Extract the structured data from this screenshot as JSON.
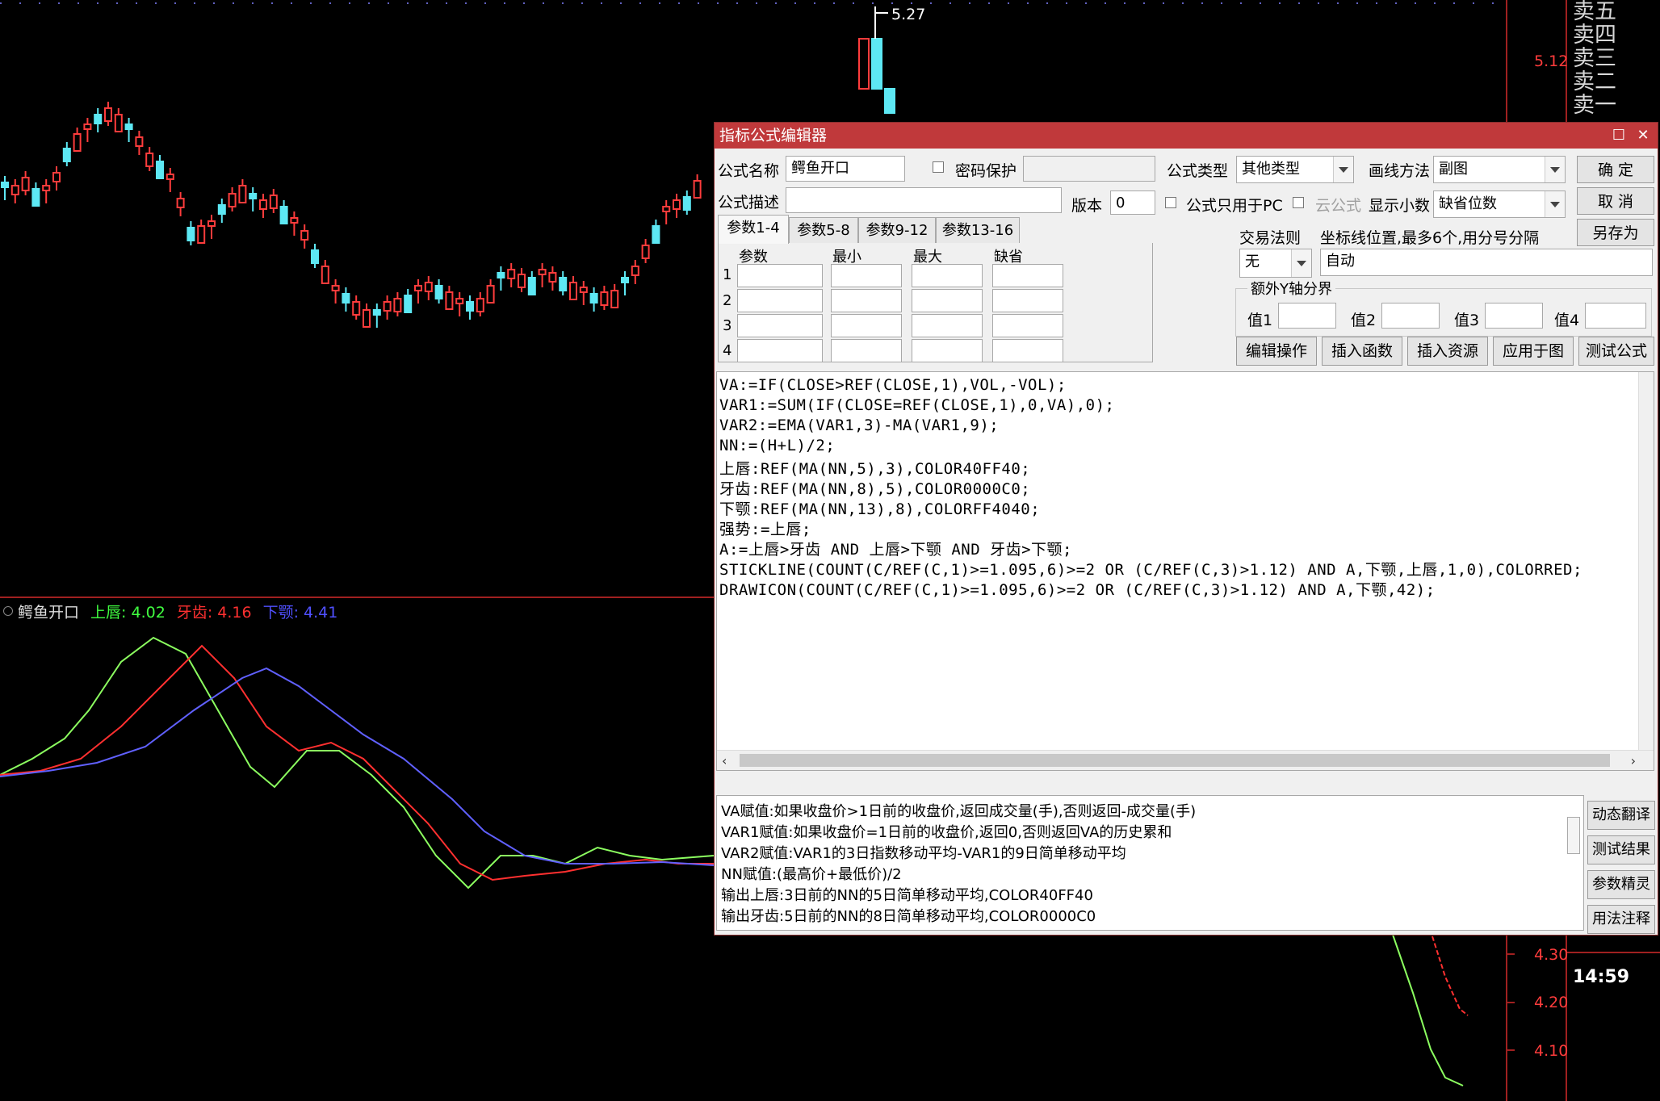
{
  "chart": {
    "price_high_label": "5.27",
    "price_axis_labels": [
      "5.12",
      "4.30",
      "4.20",
      "4.10"
    ],
    "time_label": "14:59",
    "orderbook": [
      "卖五",
      "卖四",
      "卖三",
      "卖二",
      "卖一"
    ],
    "indicator_name": "鳄鱼开口",
    "indicator_values": [
      {
        "name": "上唇",
        "value": "4.02",
        "color": "#40ff40"
      },
      {
        "name": "牙齿",
        "value": "4.16",
        "color": "#ff3030"
      },
      {
        "name": "下颚",
        "value": "4.41",
        "color": "#5050ff"
      }
    ]
  },
  "dialog": {
    "title": "指标公式编辑器",
    "labels": {
      "formula_name": "公式名称",
      "password": "密码保护",
      "formula_type": "公式类型",
      "draw_method": "画线方法",
      "formula_desc": "公式描述",
      "version": "版本",
      "pc_only": "公式只用于PC",
      "cloud": "云公式",
      "decimals": "显示小数",
      "trade_rule": "交易法则",
      "coord_hint": "坐标线位置,最多6个,用分号分隔",
      "extra_y": "额外Y轴分界",
      "val1": "值1",
      "val2": "值2",
      "val3": "值3",
      "val4": "值4"
    },
    "values": {
      "formula_name": "鳄鱼开口",
      "formula_type": "其他类型",
      "draw_method": "副图",
      "version": "0",
      "decimals": "缺省位数",
      "trade_rule": "无",
      "coord": "自动"
    },
    "buttons": {
      "ok": "确  定",
      "cancel": "取  消",
      "save_as": "另存为",
      "edit_ops": "编辑操作",
      "insert_func": "插入函数",
      "insert_res": "插入资源",
      "apply": "应用于图",
      "test": "测试公式",
      "dyn_translate": "动态翻译",
      "test_result": "测试结果",
      "param_wizard": "参数精灵",
      "usage_note": "用法注释"
    },
    "tabs": [
      "参数1-4",
      "参数5-8",
      "参数9-12",
      "参数13-16"
    ],
    "param_headers": [
      "参数",
      "最小",
      "最大",
      "缺省"
    ],
    "param_rows": [
      "1",
      "2",
      "3",
      "4"
    ],
    "code_lines": [
      "VA:=IF(CLOSE>REF(CLOSE,1),VOL,-VOL);",
      "VAR1:=SUM(IF(CLOSE=REF(CLOSE,1),0,VA),0);",
      "VAR2:=EMA(VAR1,3)-MA(VAR1,9);",
      "NN:=(H+L)/2;",
      "上唇:REF(MA(NN,5),3),COLOR40FF40;",
      "牙齿:REF(MA(NN,8),5),COLOR0000C0;",
      "下颚:REF(MA(NN,13),8),COLORFF4040;",
      "强势:=上唇;",
      "A:=上唇>牙齿 AND 上唇>下颚 AND 牙齿>下颚;",
      "STICKLINE(COUNT(C/REF(C,1)>=1.095,6)>=2 OR (C/REF(C,3)>1.12) AND A,下颚,上唇,1,0),COLORRED;",
      "DRAWICON(COUNT(C/REF(C,1)>=1.095,6)>=2 OR (C/REF(C,3)>1.12) AND A,下颚,42);"
    ],
    "explain_lines": [
      "VA赋值:如果收盘价>1日前的收盘价,返回成交量(手),否则返回-成交量(手)",
      "VAR1赋值:如果收盘价=1日前的收盘价,返回0,否则返回VA的历史累和",
      "VAR2赋值:VAR1的3日指数移动平均-VAR1的9日简单移动平均",
      "NN赋值:(最高价+最低价)/2",
      "输出上唇:3日前的NN的5日简单移动平均,COLOR40FF40",
      "输出牙齿:5日前的NN的8日简单移动平均,COLOR0000C0"
    ]
  }
}
